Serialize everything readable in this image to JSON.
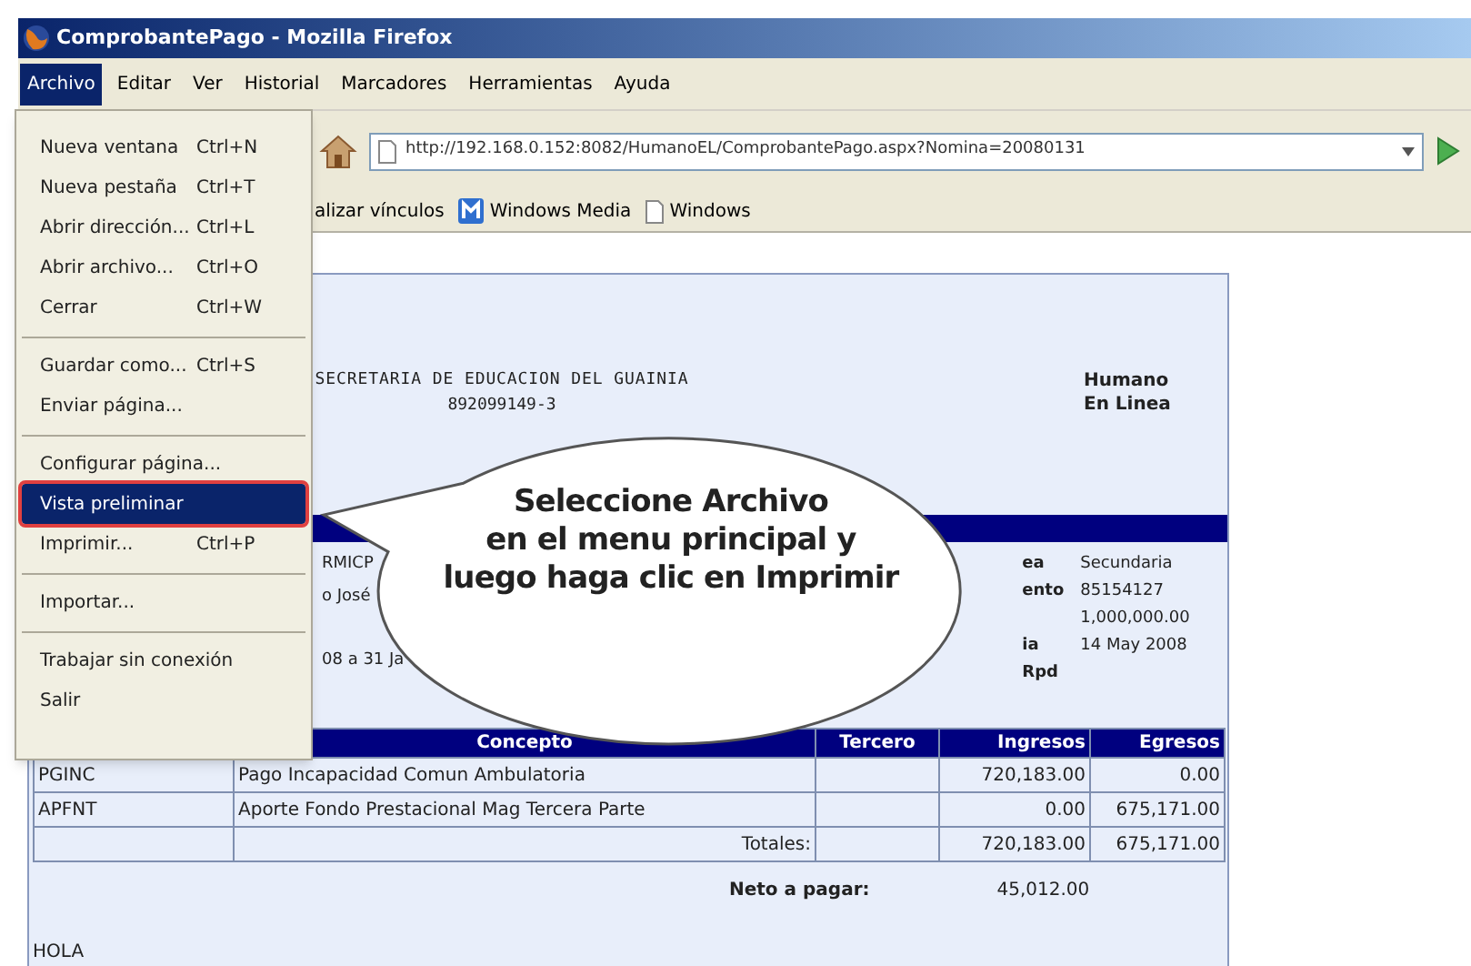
{
  "window": {
    "title": "ComprobantePago - Mozilla Firefox"
  },
  "menu_bar": [
    {
      "label": "Archivo",
      "selected": true
    },
    {
      "label": "Editar",
      "selected": false
    },
    {
      "label": "Ver",
      "selected": false
    },
    {
      "label": "Historial",
      "selected": false
    },
    {
      "label": "Marcadores",
      "selected": false
    },
    {
      "label": "Herramientas",
      "selected": false
    },
    {
      "label": "Ayuda",
      "selected": false
    }
  ],
  "file_menu": [
    {
      "kind": "item",
      "label": "Nueva ventana",
      "shortcut": "Ctrl+N",
      "selected": false
    },
    {
      "kind": "item",
      "label": "Nueva pestaña",
      "shortcut": "Ctrl+T",
      "selected": false
    },
    {
      "kind": "item",
      "label": "Abrir dirección...",
      "shortcut": "Ctrl+L",
      "selected": false
    },
    {
      "kind": "item",
      "label": "Abrir archivo...",
      "shortcut": "Ctrl+O",
      "selected": false
    },
    {
      "kind": "item",
      "label": "Cerrar",
      "shortcut": "Ctrl+W",
      "selected": false
    },
    {
      "kind": "separator"
    },
    {
      "kind": "item",
      "label": "Guardar como...",
      "shortcut": "Ctrl+S",
      "selected": false
    },
    {
      "kind": "item",
      "label": "Enviar página...",
      "selected": false
    },
    {
      "kind": "separator"
    },
    {
      "kind": "item",
      "label": "Configurar página...",
      "selected": false
    },
    {
      "kind": "item",
      "label": "Vista preliminar",
      "selected": true
    },
    {
      "kind": "item",
      "label": "Imprimir...",
      "shortcut": "Ctrl+P",
      "selected": false
    },
    {
      "kind": "separator"
    },
    {
      "kind": "item",
      "label": "Importar...",
      "selected": false
    },
    {
      "kind": "separator"
    },
    {
      "kind": "item",
      "label": "Trabajar sin conexión",
      "selected": false
    },
    {
      "kind": "item",
      "label": "Salir",
      "selected": false
    }
  ],
  "address_bar": {
    "url": "http://192.168.0.152:8082/HumanoEL/ComprobantePago.aspx?Nomina=20080131"
  },
  "bookmarks": [
    {
      "kind": "plain",
      "label": "alizar vínculos"
    },
    {
      "kind": "media",
      "label": "Windows Media"
    },
    {
      "kind": "page",
      "label": "Windows"
    }
  ],
  "document": {
    "organization": "SECRETARIA DE EDUCACION DEL GUAINIA",
    "nit": "892099149-3",
    "brand": [
      "Humano",
      "En Linea"
    ],
    "info_left": [
      "RMICP",
      "o José",
      "08 a 31 Ja"
    ],
    "info_right": [
      {
        "label": "ea",
        "value": "Secundaria"
      },
      {
        "label": "ento",
        "value": "85154127"
      },
      {
        "value": "1,000,000.00"
      },
      {
        "label": "ia",
        "value": "14 May 2008"
      },
      {
        "label": "Rpd"
      }
    ],
    "table": {
      "columns": [
        "Concepto",
        "Tercero",
        "Ingresos",
        "Egresos"
      ],
      "rows": [
        {
          "code": "PGINC",
          "concept": "Pago Incapacidad Comun Ambulatoria",
          "income": "720,183.00",
          "expense": "0.00"
        },
        {
          "code": "APFNT",
          "concept": "Aporte Fondo Prestacional Mag Tercera Parte",
          "income": "0.00",
          "expense": "675,171.00"
        }
      ],
      "totals": {
        "label": "Totales:",
        "income": "720,183.00",
        "expense": "675,171.00"
      }
    },
    "net": {
      "label": "Neto a pagar:",
      "value": "45,012.00"
    },
    "note": "HOLA"
  },
  "callout": {
    "lines": [
      "Seleccione Archivo",
      "en el menu principal y",
      "luego haga clic en Imprimir"
    ]
  }
}
